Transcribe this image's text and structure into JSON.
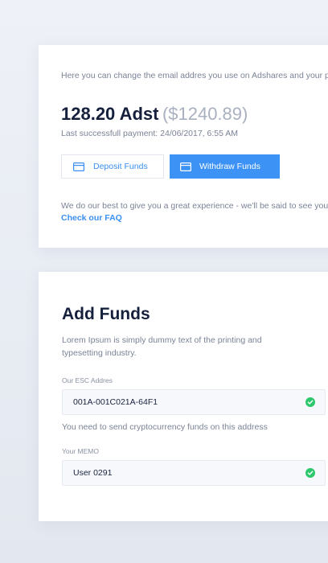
{
  "balance_card": {
    "intro_text": "Here you can change the email addres you use on Adshares and your pa",
    "balance_amount": "128.20 Adst",
    "balance_usd": "($1240.89)",
    "last_payment": "Last successfull payment: 24/06/2017, 6:55 AM",
    "deposit_label": "Deposit Funds",
    "deposit_icon": "card-icon",
    "withdraw_label": "Withdraw Funds",
    "withdraw_icon": "card-icon",
    "info_text": "We do our best to give you a great experience - we'll be said to see you",
    "faq_link": "Check our FAQ"
  },
  "add_funds": {
    "title": "Add Funds",
    "description": "Lorem Ipsum is simply dummy text of the printing and typesetting industry.",
    "esc_label": "Our ESC Addres",
    "esc_value": "001A-001C021A-64F1",
    "esc_hint": "You need to send cryptocurrency funds on this address",
    "memo_label": "Your MEMO",
    "memo_value": "User 0291",
    "check_icon": "check-circle-icon"
  },
  "colors": {
    "accent": "#3d93f5",
    "link": "#3b8ff0",
    "success": "#2dc76d",
    "heading": "#16203d",
    "muted": "#7a8396"
  }
}
